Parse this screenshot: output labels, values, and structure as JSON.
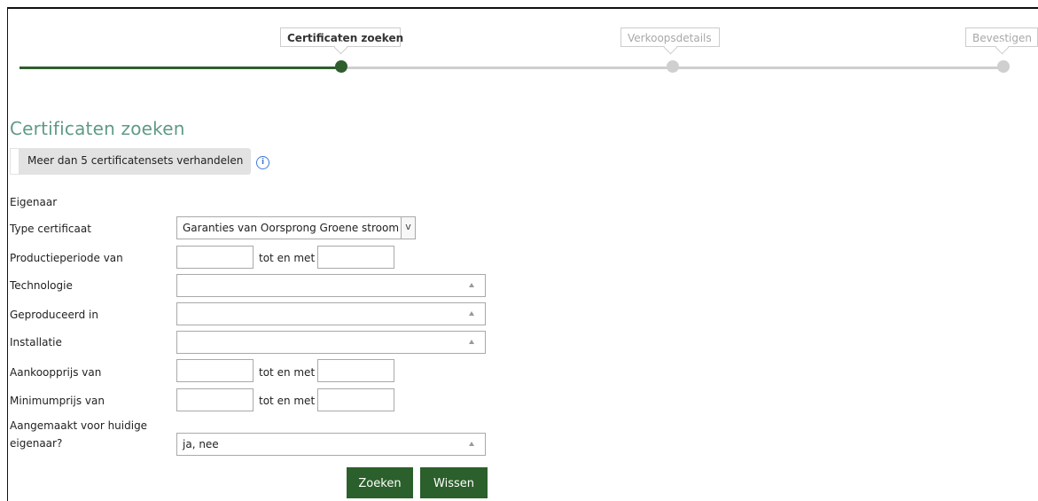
{
  "stepper": {
    "steps": [
      {
        "label": "Certificaten zoeken",
        "state": "active"
      },
      {
        "label": "Verkoopsdetails",
        "state": "inactive"
      },
      {
        "label": "Bevestigen",
        "state": "inactive"
      }
    ],
    "colors": {
      "active": "#2e5e2e",
      "inactive": "#cfcfcf"
    }
  },
  "page": {
    "title": "Certificaten zoeken",
    "toggle_label": "Meer dan 5 certificatensets verhandelen",
    "info_icon": "info-icon",
    "info_glyph": "i"
  },
  "form": {
    "owner_label": "Eigenaar",
    "type_label": "Type certificaat",
    "type_value": "Garanties van Oorsprong Groene stroom",
    "type_dropdown_glyph": "v",
    "period_label": "Productieperiode van",
    "tot_label": "tot en met",
    "tech_label": "Technologie",
    "produced_label": "Geproduceerd in",
    "installation_label": "Installatie",
    "purchase_label": "Aankoopprijs van",
    "minprice_label": "Minimumprijs van",
    "created_label_line1": "Aangemaakt voor huidige",
    "created_label_line2": "eigenaar?",
    "created_value": "ja, nee"
  },
  "buttons": {
    "search": "Zoeken",
    "clear": "Wissen"
  }
}
